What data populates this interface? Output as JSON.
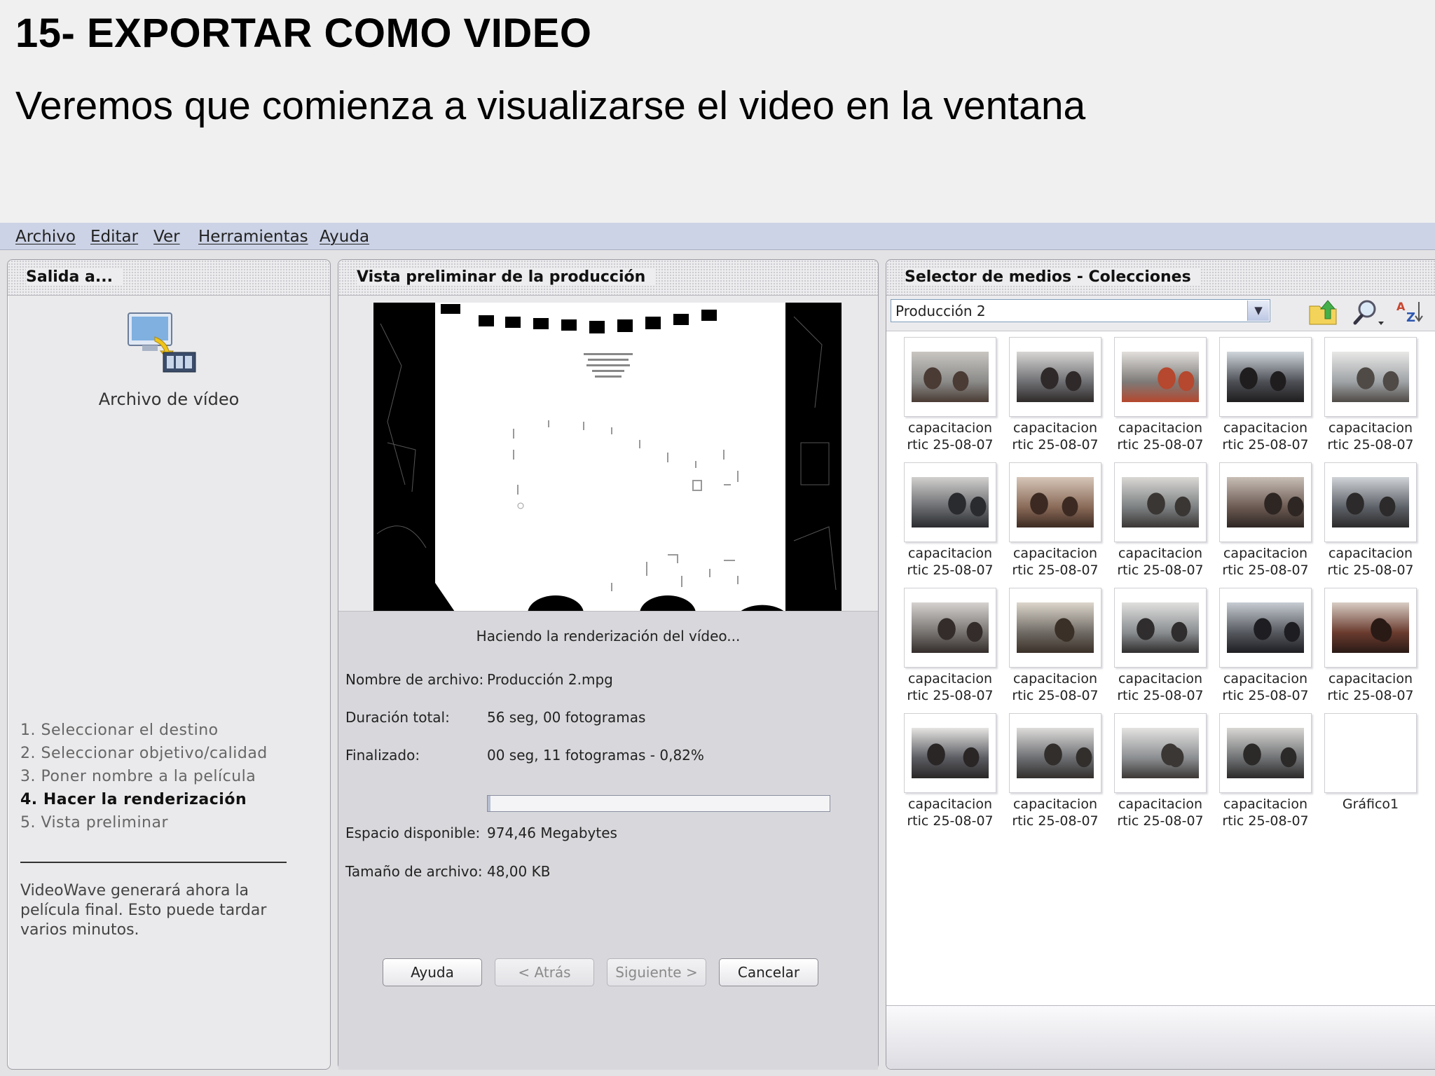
{
  "slide": {
    "title": "15- EXPORTAR COMO VIDEO",
    "subtitle": "Veremos que comienza a visualizarse el video en la ventana"
  },
  "menu": [
    "Archivo",
    "Editar",
    "Ver",
    "Herramientas",
    "Ayuda"
  ],
  "output_panel": {
    "header": "Salida a...",
    "option_label": "Archivo de vídeo",
    "steps": [
      "1. Seleccionar el destino",
      "2. Seleccionar objetivo/calidad",
      "3. Poner nombre a la película",
      "4. Hacer la renderización",
      "5. Vista preliminar"
    ],
    "current_step": 3,
    "note": "VideoWave generará ahora la película final. Esto puede tardar varios minutos."
  },
  "preview_panel": {
    "header": "Vista preliminar de la producción",
    "status": "Haciendo la renderización del vídeo...",
    "fields": {
      "filename_label": "Nombre de archivo:",
      "filename_value": "Producción 2.mpg",
      "duration_label": "Duración total:",
      "duration_value": "56 seg, 00 fotogramas",
      "done_label": "Finalizado:",
      "done_value": "00 seg, 11 fotogramas - 0,82%",
      "space_label": "Espacio disponible:",
      "space_value": "974,46 Megabytes",
      "size_label": "Tamaño de archivo:",
      "size_value": "48,00 KB"
    },
    "progress_fraction": 0.0082,
    "buttons": {
      "help": "Ayuda",
      "back": "< Atrás",
      "next": "Siguiente >",
      "cancel": "Cancelar"
    }
  },
  "media_panel": {
    "header": "Selector de medios - Colecciones",
    "collection": "Producción 2",
    "items": [
      {
        "label": "capacitacion rtic 25-08-07",
        "colors": [
          "#8a8a88",
          "#4a3b34",
          "#c9c6c2"
        ]
      },
      {
        "label": "capacitacion rtic 25-08-07",
        "colors": [
          "#6e6f73",
          "#2f2a29",
          "#d8d6d4"
        ]
      },
      {
        "label": "capacitacion rtic 25-08-07",
        "colors": [
          "#7d7a78",
          "#b5482e",
          "#e2dfdc"
        ]
      },
      {
        "label": "capacitacion rtic 25-08-07",
        "colors": [
          "#4d4f55",
          "#1f1d1e",
          "#cfd6dc"
        ]
      },
      {
        "label": "capacitacion rtic 25-08-07",
        "colors": [
          "#9fa3a6",
          "#4f4a46",
          "#e8e8e6"
        ]
      },
      {
        "label": "capacitacion rtic 25-08-07",
        "colors": [
          "#6a6c70",
          "#2a2b2e",
          "#d2d0ce"
        ]
      },
      {
        "label": "capacitacion rtic 25-08-07",
        "colors": [
          "#8a6a58",
          "#3c2a22",
          "#d6c6b8"
        ]
      },
      {
        "label": "capacitacion rtic 25-08-07",
        "colors": [
          "#7c8082",
          "#3a3634",
          "#dad8d5"
        ]
      },
      {
        "label": "capacitacion rtic 25-08-07",
        "colors": [
          "#6b5a52",
          "#2e2623",
          "#c8beb6"
        ]
      },
      {
        "label": "capacitacion rtic 25-08-07",
        "colors": [
          "#5d6168",
          "#2c2a2a",
          "#d0d4d8"
        ]
      },
      {
        "label": "capacitacion rtic 25-08-07",
        "colors": [
          "#777370",
          "#332c2a",
          "#d5d2cf"
        ]
      },
      {
        "label": "capacitacion rtic 25-08-07",
        "colors": [
          "#6f6a64",
          "#3a3028",
          "#dcd6cc"
        ]
      },
      {
        "label": "capacitacion rtic 25-08-07",
        "colors": [
          "#898d90",
          "#2f2d2d",
          "#e0e0de"
        ]
      },
      {
        "label": "capacitacion rtic 25-08-07",
        "colors": [
          "#55585e",
          "#1e1e22",
          "#c6ccd2"
        ]
      },
      {
        "label": "capacitacion rtic 25-08-07",
        "colors": [
          "#6a3b2e",
          "#2a1a16",
          "#d8ccc4"
        ]
      },
      {
        "label": "capacitacion rtic 25-08-07",
        "colors": [
          "#5a5c62",
          "#2a2626",
          "#e6e4e2"
        ]
      },
      {
        "label": "capacitacion rtic 25-08-07",
        "colors": [
          "#6c6e72",
          "#322e2c",
          "#dedcda"
        ]
      },
      {
        "label": "capacitacion rtic 25-08-07",
        "colors": [
          "#8b8e91",
          "#3b3735",
          "#e4e3e1"
        ]
      },
      {
        "label": "capacitacion rtic 25-08-07",
        "colors": [
          "#6f7274",
          "#2c2a29",
          "#d9d7d4"
        ]
      },
      {
        "label": "Gráfico1",
        "colors": []
      }
    ]
  }
}
